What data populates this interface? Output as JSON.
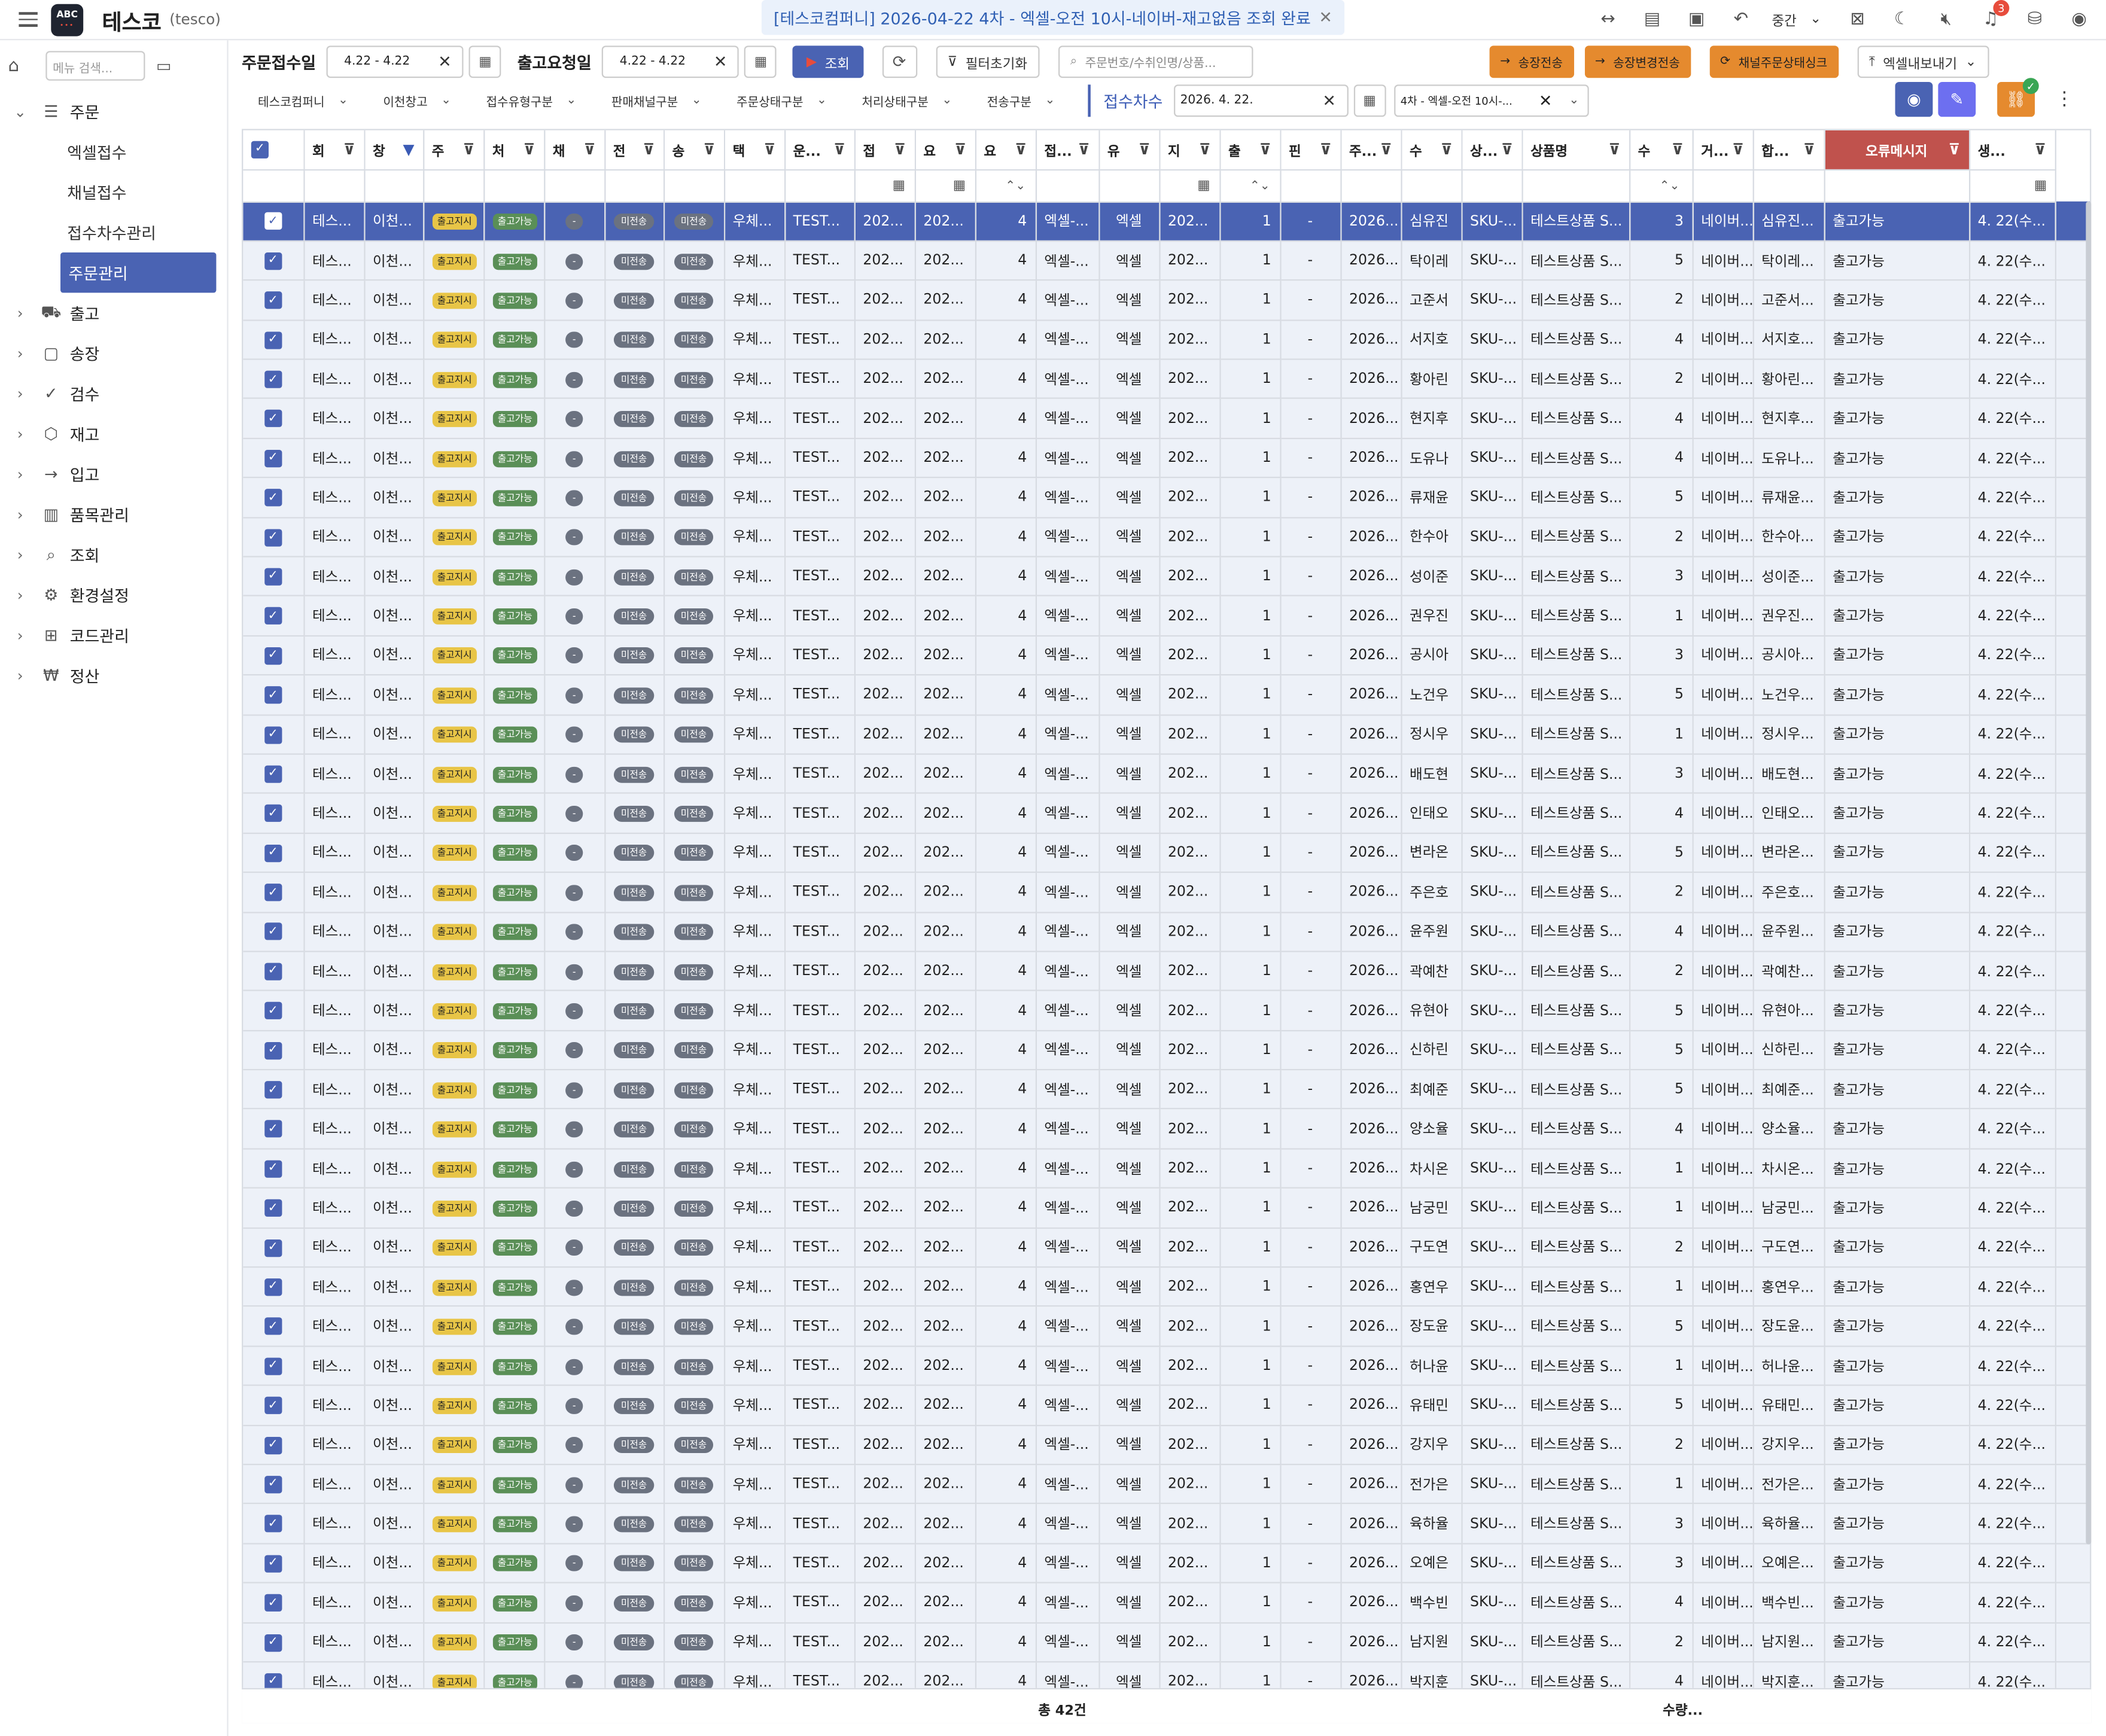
{
  "app": {
    "brand": "테스코",
    "brand_sub": "(tesco)",
    "logo": "ABC"
  },
  "notice": {
    "text": "[테스코컴퍼니] 2026-04-22 4차 - 엑셀-오전 10시-네이버-재고없음 조회 완료"
  },
  "topbar": {
    "size_label": "중간",
    "notification_count": "3"
  },
  "sidebar": {
    "search_placeholder": "메뉴 검색...",
    "menu": [
      {
        "label": "주문",
        "icon": "list-icon",
        "expanded": true
      },
      {
        "label": "출고",
        "icon": "truck-icon"
      },
      {
        "label": "송장",
        "icon": "document-icon"
      },
      {
        "label": "검수",
        "icon": "check-icon"
      },
      {
        "label": "재고",
        "icon": "box-icon"
      },
      {
        "label": "입고",
        "icon": "arrow-right-icon"
      },
      {
        "label": "품목관리",
        "icon": "gift-icon"
      },
      {
        "label": "조회",
        "icon": "search-icon"
      },
      {
        "label": "환경설정",
        "icon": "gear-icon"
      },
      {
        "label": "코드관리",
        "icon": "plus-square-icon"
      },
      {
        "label": "정산",
        "icon": "won-icon"
      }
    ],
    "submenu": [
      "엑셀접수",
      "채널접수",
      "접수차수관리",
      "주문관리"
    ],
    "active_sub": "주문관리"
  },
  "filters": {
    "order_date_label": "주문접수일",
    "order_date": "4.22 - 4.22",
    "ship_date_label": "출고요청일",
    "ship_date": "4.22 - 4.22",
    "search_btn": "조회",
    "reset_btn": "필터초기화",
    "search_placeholder": "주문번호/수취인명/상품...",
    "btn_send": "송장전송",
    "btn_change": "송장변경전송",
    "btn_sync": "채널주문상태싱크",
    "btn_export": "엑셀내보내기"
  },
  "filters2": {
    "dropdowns": [
      "테스코컴퍼니",
      "이천창고",
      "접수유형구분",
      "판매채널구분",
      "주문상태구분",
      "처리상태구분",
      "전송구분"
    ],
    "round_label": "접수차수",
    "round_date": "2026. 4. 22.",
    "round_select": "4차 - 엑셀-오전 10시-..."
  },
  "table": {
    "headers": [
      "회",
      "창",
      "주",
      "처",
      "채",
      "전",
      "송",
      "택",
      "운...",
      "접",
      "요",
      "요",
      "접...",
      "유",
      "지",
      "출",
      "핀",
      "주...",
      "수",
      "상...",
      "상품명",
      "수",
      "거...",
      "합...",
      "오류메시지",
      "생..."
    ],
    "fixed": {
      "c1": "테스...",
      "c2": "이천...",
      "badge1": "출고지시",
      "badge2": "출고가능",
      "badge3": "-",
      "badge4": "미전송",
      "badge5": "미전송",
      "c8": "우체...",
      "c9": "TEST...",
      "c10": "202...",
      "c11": "202...",
      "c12": "4",
      "c13": "엑셀-...",
      "c14": "엑셀",
      "c15": "202...",
      "c16": "1",
      "c17": "-",
      "c18": "2026...",
      "c20": "SKU-...",
      "c21": "테스트상품 S...",
      "c23": "네이버...",
      "c25": "출고가능",
      "c26": "4. 22(수..."
    },
    "rows": [
      [
        "심유진",
        "3",
        "심유진..."
      ],
      [
        "탁이레",
        "5",
        "탁이레..."
      ],
      [
        "고준서",
        "2",
        "고준서..."
      ],
      [
        "서지호",
        "4",
        "서지호..."
      ],
      [
        "황아린",
        "2",
        "황아린..."
      ],
      [
        "현지후",
        "4",
        "현지후..."
      ],
      [
        "도유나",
        "4",
        "도유나..."
      ],
      [
        "류재윤",
        "5",
        "류재윤..."
      ],
      [
        "한수아",
        "2",
        "한수아..."
      ],
      [
        "성이준",
        "3",
        "성이준..."
      ],
      [
        "권우진",
        "1",
        "권우진..."
      ],
      [
        "공시아",
        "3",
        "공시아..."
      ],
      [
        "노건우",
        "5",
        "노건우..."
      ],
      [
        "정시우",
        "1",
        "정시우..."
      ],
      [
        "배도현",
        "3",
        "배도현..."
      ],
      [
        "인태오",
        "4",
        "인태오..."
      ],
      [
        "변라온",
        "5",
        "변라온..."
      ],
      [
        "주은호",
        "2",
        "주은호..."
      ],
      [
        "윤주원",
        "4",
        "윤주원..."
      ],
      [
        "곽예찬",
        "2",
        "곽예찬..."
      ],
      [
        "유현아",
        "5",
        "유현아..."
      ],
      [
        "신하린",
        "5",
        "신하린..."
      ],
      [
        "최예준",
        "5",
        "최예준..."
      ],
      [
        "양소율",
        "4",
        "양소율..."
      ],
      [
        "차시온",
        "1",
        "차시온..."
      ],
      [
        "남궁민",
        "1",
        "남궁민..."
      ],
      [
        "구도연",
        "2",
        "구도연..."
      ],
      [
        "홍연우",
        "1",
        "홍연우..."
      ],
      [
        "장도윤",
        "5",
        "장도윤..."
      ],
      [
        "허나윤",
        "1",
        "허나윤..."
      ],
      [
        "유태민",
        "5",
        "유태민..."
      ],
      [
        "강지우",
        "2",
        "강지우..."
      ],
      [
        "전가은",
        "1",
        "전가은..."
      ],
      [
        "육하율",
        "3",
        "육하율..."
      ],
      [
        "오예은",
        "3",
        "오예은..."
      ],
      [
        "백수빈",
        "4",
        "백수빈..."
      ],
      [
        "남지원",
        "2",
        "남지원..."
      ],
      [
        "박지훈",
        "4",
        "박지훈..."
      ]
    ],
    "footer_total": "총 42건",
    "footer_qty": "수량..."
  }
}
